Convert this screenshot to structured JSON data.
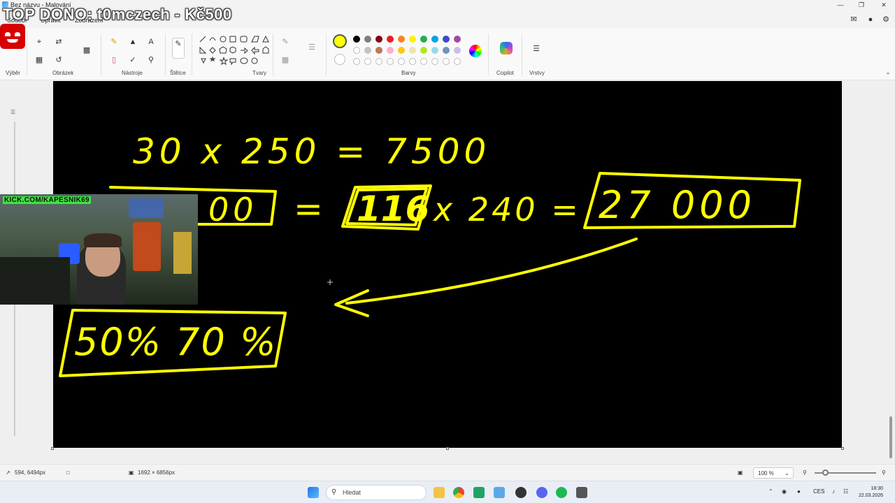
{
  "window": {
    "title": "Bez názvu - Malování"
  },
  "overlay": {
    "top_dono": "TOP DONO: t0mczech - Kč500"
  },
  "menu": {
    "file": "Soubor",
    "edit": "Upravit",
    "view": "Zobrazení"
  },
  "ribbon": {
    "groups": {
      "select": "Výběr",
      "image": "Obrázek",
      "tools": "Nástroje",
      "brushes": "Štětce",
      "shapes": "Tvary",
      "colors": "Barvy",
      "copilot": "Copilot",
      "layers": "Vrstvy"
    },
    "palette_row1": [
      "#000000",
      "#7f7f7f",
      "#880015",
      "#ed1c24",
      "#ff7f27",
      "#fff200",
      "#22b14c",
      "#00a2e8",
      "#3f48cc",
      "#a349a4"
    ],
    "palette_row2": [
      "#ffffff",
      "#c3c3c3",
      "#b97a57",
      "#ffaec9",
      "#ffc90e",
      "#efe4b0",
      "#b5e61d",
      "#99d9ea",
      "#7092be",
      "#c8bfe7"
    ],
    "active_color": "#ffff00"
  },
  "canvas": {
    "ink_color": "#ffff00",
    "line1": "30 x 250 = 7500",
    "line2_left": "00",
    "line2_eq": "=",
    "line2_boxed": "116",
    "line2_mult": "x 240 =",
    "line2_result": "27 000",
    "line3": "50% 70 %"
  },
  "webcam": {
    "label": "KICK.COM/KAPESNIK69"
  },
  "status": {
    "cursor_pos": "594, 6494px",
    "canvas_size": "1692 × 6856px",
    "zoom": "100 %"
  },
  "taskbar": {
    "search_placeholder": "Hledat",
    "language": "CES",
    "time": "18:30",
    "date": "22.03.2026"
  }
}
